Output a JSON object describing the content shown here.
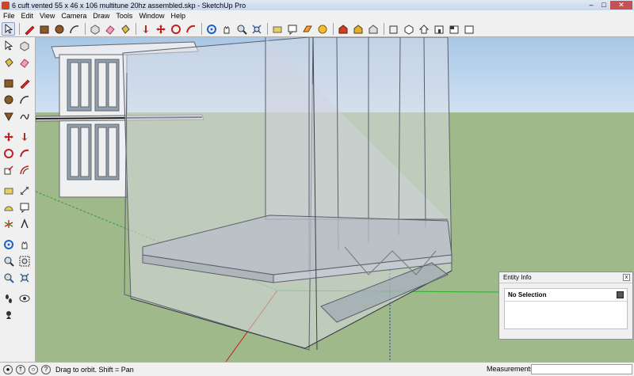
{
  "window": {
    "title": "6 cuft vented 55 x 46 x 106 multitune 20hz assembled.skp - SketchUp Pro"
  },
  "menu": [
    "File",
    "Edit",
    "View",
    "Camera",
    "Draw",
    "Tools",
    "Window",
    "Help"
  ],
  "toolbar_icons": [
    "select-icon",
    "pencil-icon",
    "rectangle-icon",
    "circle-icon",
    "arc-icon",
    "make-component-icon",
    "eraser-icon",
    "paint-bucket-icon",
    "push-pull-icon",
    "move-icon",
    "rotate-icon",
    "follow-me-icon",
    "orbit-icon",
    "pan-icon",
    "zoom-icon",
    "zoom-extents-icon",
    "tape-measure-icon",
    "text-icon",
    "section-plane-icon",
    "shadows-icon",
    "3d-warehouse-icon",
    "get-models-icon",
    "share-model-icon",
    "components-icon",
    "iso-view-icon",
    "top-view-icon",
    "front-view-icon",
    "right-view-icon",
    "back-view-icon",
    "left-view-icon"
  ],
  "entity_info": {
    "title": "Entity Info",
    "selection": "No Selection",
    "close": "x"
  },
  "status": {
    "hint": "Drag to orbit.  Shift = Pan",
    "measurements_label": "Measurements",
    "measurements_value": ""
  },
  "colors": {
    "sky": "#b8d4ee",
    "ground": "#9fb98a",
    "model": "#c8c8d6"
  }
}
